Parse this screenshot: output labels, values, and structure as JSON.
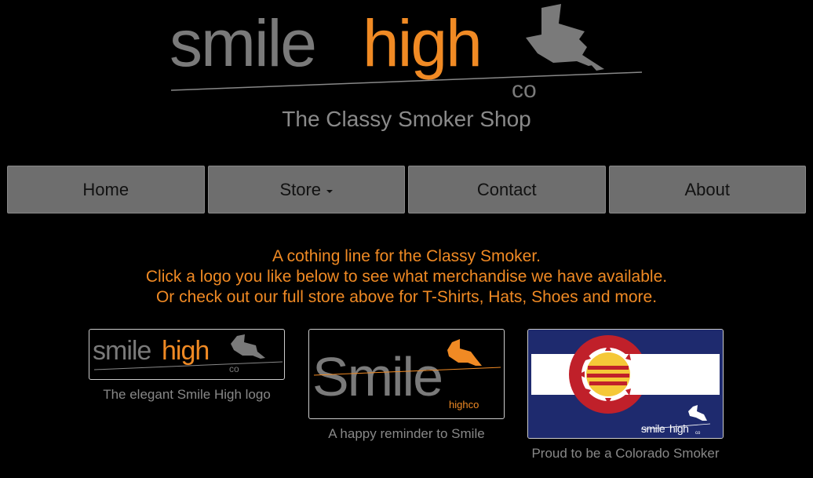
{
  "brand": {
    "word_gray": "smile",
    "word_orange": "high",
    "suffix": "co",
    "tagline": "The Classy Smoker Shop"
  },
  "nav": {
    "items": [
      {
        "label": "Home"
      },
      {
        "label": "Store"
      },
      {
        "label": "Contact"
      },
      {
        "label": "About"
      }
    ]
  },
  "intro": {
    "lines": [
      "A cothing line for the Classy Smoker.",
      "Click a logo you like below to see what merchandise we have available.",
      "Or check out our full store above for T-Shirts, Hats, Shoes and more."
    ]
  },
  "gallery": [
    {
      "caption": "The elegant Smile High logo",
      "logo": {
        "word_gray": "smile",
        "word_orange": "high",
        "suffix": "co"
      }
    },
    {
      "caption": "A happy reminder to Smile",
      "logo": {
        "word_gray": "Smile",
        "suffix": "highco"
      }
    },
    {
      "caption": "Proud to be a Colorado Smoker",
      "logo": {
        "word_gray": "smile",
        "word_orange": "high",
        "suffix": "co"
      }
    }
  ],
  "colors": {
    "background": "#000000",
    "accent": "#f08a24",
    "nav_button": "#6e6e6e",
    "text_gray": "#888888",
    "flag_blue": "#1e2a6e",
    "flag_red": "#c0202a"
  }
}
